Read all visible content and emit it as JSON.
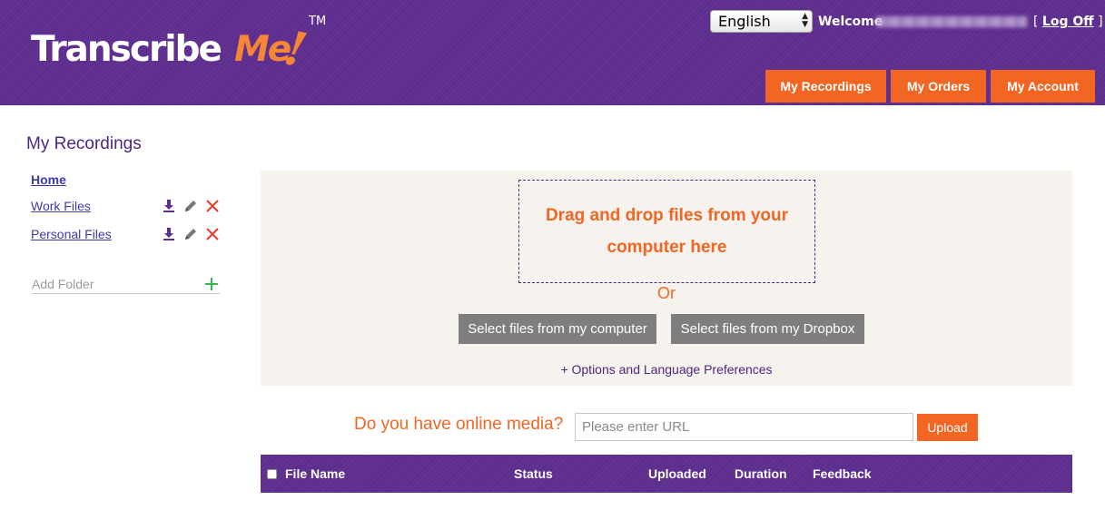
{
  "header": {
    "logo": {
      "main": "Transcribe",
      "accent": "Me",
      "bang": "!",
      "tm": "TM"
    },
    "language": {
      "selected": "English"
    },
    "welcome_label": "Welcome",
    "logoff": {
      "open": "[",
      "label": "Log Off",
      "close": "]"
    },
    "nav": {
      "recordings_label": "My Recordings",
      "orders_label": "My Orders",
      "account_label": "My Account"
    }
  },
  "sidebar": {
    "title": "My Recordings",
    "home_label": "Home",
    "folders": [
      {
        "label": "Work Files"
      },
      {
        "label": "Personal Files"
      }
    ],
    "add_folder_placeholder": "Add Folder"
  },
  "upload": {
    "dropzone_text": "Drag and drop files from your computer here",
    "or_label": "Or",
    "select_computer_label": "Select files from my computer",
    "select_dropbox_label": "Select files from my Dropbox",
    "options_label": "+ Options and Language Preferences"
  },
  "online_media": {
    "label": "Do you have online media?",
    "url_placeholder": "Please enter URL",
    "upload_label": "Upload"
  },
  "table": {
    "columns": {
      "file_name": "File Name",
      "status": "Status",
      "uploaded": "Uploaded",
      "duration": "Duration",
      "feedback": "Feedback"
    }
  },
  "colors": {
    "brand_purple": "#5d2e8e",
    "accent_orange": "#f26522",
    "panel_bg": "#f6f2ee",
    "gray_button": "#7e7e7e",
    "delete_red": "#e8392a",
    "add_green": "#3cb64a"
  },
  "icons": {
    "download": "download-icon",
    "edit": "pencil-icon",
    "delete": "close-icon",
    "add": "plus-icon"
  }
}
